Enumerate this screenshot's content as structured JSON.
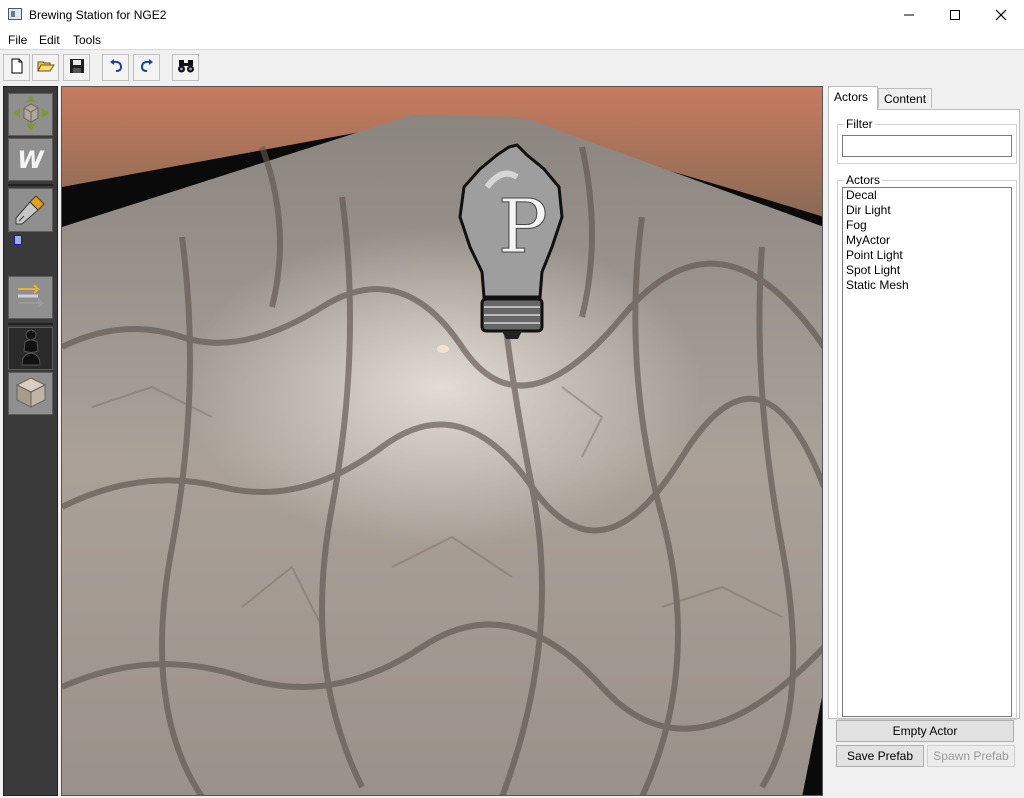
{
  "window": {
    "title": "Brewing Station for NGE2",
    "controls": [
      "minimize-icon",
      "maximize-icon",
      "close-icon"
    ]
  },
  "menu": {
    "items": [
      {
        "label": "File"
      },
      {
        "label": "Edit"
      },
      {
        "label": "Tools"
      }
    ]
  },
  "toolbar": {
    "buttons": [
      "new-file-icon",
      "open-folder-icon",
      "save-icon",
      "undo-icon",
      "redo-icon",
      "binoculars-icon"
    ]
  },
  "tools": {
    "items": [
      "move-gizmo-icon",
      "world-space-icon",
      "screwdriver-icon",
      "align-arrows-icon",
      "pawn-icon",
      "cube-icon"
    ],
    "world_label": "W"
  },
  "viewport": {
    "billboard_letter": "P",
    "billboard": "point-light-bulb-icon"
  },
  "panel": {
    "tabs": [
      {
        "label": "Actors",
        "active": true
      },
      {
        "label": "Content",
        "active": false
      }
    ],
    "filter": {
      "title": "Filter",
      "value": ""
    },
    "actors": {
      "title": "Actors",
      "items": [
        "Decal",
        "Dir Light",
        "Fog",
        "MyActor",
        "Point Light",
        "Spot Light",
        "Static Mesh"
      ]
    },
    "buttons": {
      "empty_actor": "Empty Actor",
      "save_prefab": "Save Prefab",
      "spawn_prefab": "Spawn Prefab"
    }
  },
  "colors": {
    "panel_dark": "#3a3a3a",
    "tool_bg": "#8f8f8f",
    "ground": "#a39a92",
    "crack": "#6b615a",
    "sky_terrain": "#b8725a"
  }
}
